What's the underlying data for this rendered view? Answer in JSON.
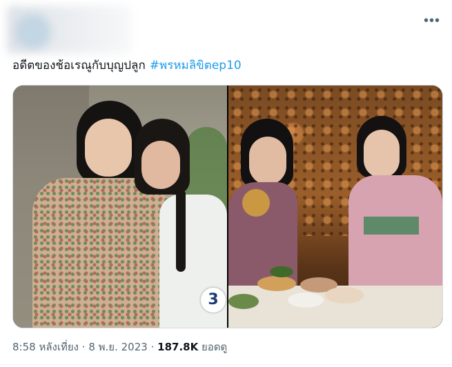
{
  "tweet": {
    "text": "อดีตของช้อเรณูกับบุญปลูก",
    "hashtag": "#พรหมลิขิตep10",
    "more_icon": "more-horizontal-icon"
  },
  "media": {
    "photo_count": 2,
    "channel_logo": "3"
  },
  "meta": {
    "time": "8:58 หลังเที่ยง",
    "date": "8 พ.ย. 2023",
    "views_count": "187.8K",
    "views_label": "ยอดดู",
    "separator": "·"
  }
}
